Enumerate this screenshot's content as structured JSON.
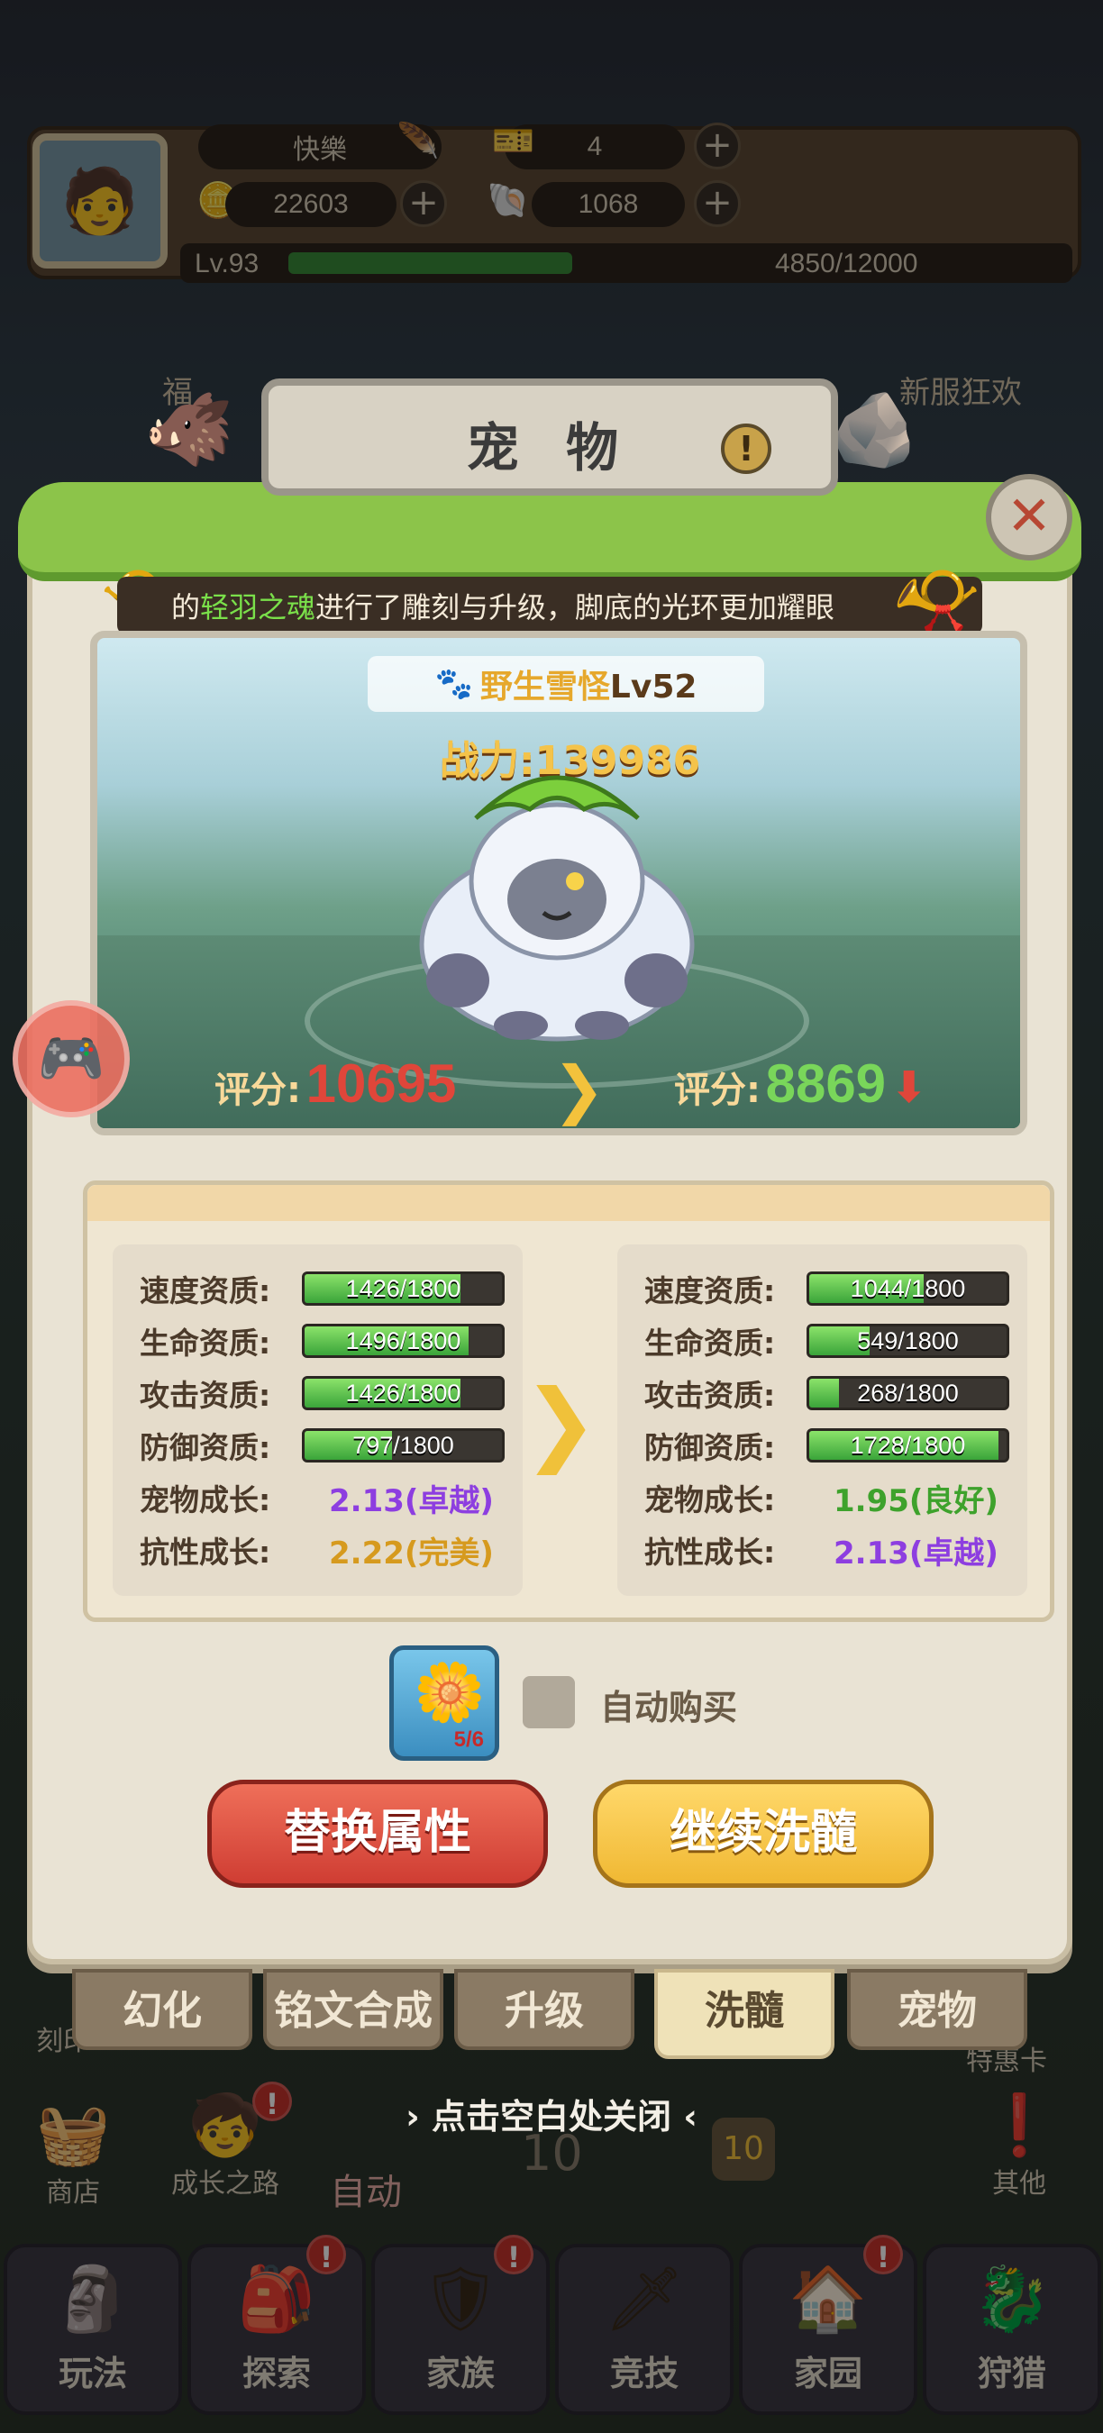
{
  "player": {
    "name": "快樂",
    "gold": "22603",
    "tickets": "4",
    "shells": "1068",
    "level": "Lv.93",
    "xp": "4850/12000",
    "xp_progress": 0.404
  },
  "top_events": {
    "left": "福",
    "right": "新服狂欢"
  },
  "modal": {
    "title": "宠 物",
    "announcement_prefix": "的",
    "announcement_name": "轻羽之魂",
    "announcement_text": "进行了雕刻与升级，脚底的光环更加耀眼"
  },
  "pet": {
    "name": "野生雪怪",
    "level": "Lv52",
    "power_label": "战力:",
    "power": "139986",
    "score_label": "评分:",
    "score_current": "10695",
    "score_new": "8869"
  },
  "stats": {
    "current": [
      {
        "label": "速度资质:",
        "value": "1426/1800",
        "progress": 0.792
      },
      {
        "label": "生命资质:",
        "value": "1496/1800",
        "progress": 0.831
      },
      {
        "label": "攻击资质:",
        "value": "1426/1800",
        "progress": 0.792
      },
      {
        "label": "防御资质:",
        "value": "797/1800",
        "progress": 0.443
      }
    ],
    "current_growth": {
      "label": "宠物成长:",
      "value": "2.13(卓越)"
    },
    "current_resist": {
      "label": "抗性成长:",
      "value": "2.22(完美)"
    },
    "new": [
      {
        "label": "速度资质:",
        "value": "1044/1800",
        "progress": 0.58
      },
      {
        "label": "生命资质:",
        "value": "549/1800",
        "progress": 0.305
      },
      {
        "label": "攻击资质:",
        "value": "268/1800",
        "progress": 0.149
      },
      {
        "label": "防御资质:",
        "value": "1728/1800",
        "progress": 0.96
      }
    ],
    "new_growth": {
      "label": "宠物成长:",
      "value": "1.95(良好)"
    },
    "new_resist": {
      "label": "抗性成长:",
      "value": "2.13(卓越)"
    }
  },
  "item": {
    "count": "5/6",
    "auto_buy_label": "自动购买"
  },
  "buttons": {
    "replace": "替换属性",
    "continue": "继续洗髓"
  },
  "tabs": [
    "幻化",
    "铭文合成",
    "升级",
    "洗髓",
    "宠物"
  ],
  "active_tab": "洗髓",
  "close_hint": "点击空白处关闭",
  "background": {
    "left_items": [
      "刻印",
      "商店",
      "成长之路"
    ],
    "auto_label": "自动",
    "right_items": [
      "特惠卡",
      "其他"
    ],
    "wave_number": "10",
    "wave_badge": "10"
  },
  "bottom_nav": [
    "玩法",
    "探索",
    "家族",
    "竞技",
    "家园",
    "狩猎"
  ],
  "colors": {
    "score_down": "#e0463a",
    "score_up": "#79d65a",
    "excellent": "#8d3ee0",
    "perfect": "#d69a1e",
    "good": "#3ea22c"
  }
}
